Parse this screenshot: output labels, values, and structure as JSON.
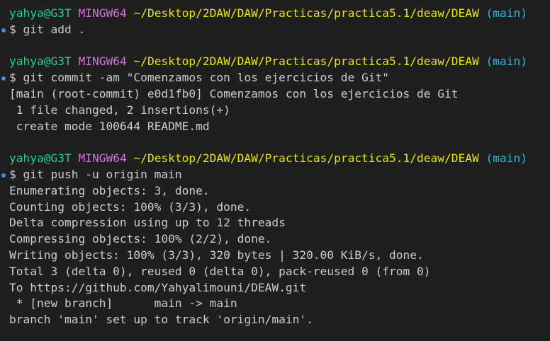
{
  "prompt": {
    "user": "yahya@G3T",
    "system": "MINGW64",
    "path": "~/Desktop/2DAW/DAW/Practicas/practica5.1/deaw/DEAW",
    "branch": "(main)"
  },
  "colors": {
    "background": "#1f1f1f",
    "text": "#cccccc",
    "user": "#23d18b",
    "system": "#d670d6",
    "path": "#e5e510",
    "branch": "#29b8db",
    "command_marker": "#3b8eea"
  },
  "lines": [
    {
      "type": "prompt"
    },
    {
      "type": "command",
      "text": "$ git add ."
    },
    {
      "type": "blank"
    },
    {
      "type": "prompt"
    },
    {
      "type": "command",
      "text": "$ git commit -am \"Comenzamos con los ejercicios de Git\""
    },
    {
      "type": "output",
      "text": "[main (root-commit) e0d1fb0] Comenzamos con los ejercicios de Git"
    },
    {
      "type": "output",
      "text": " 1 file changed, 2 insertions(+)"
    },
    {
      "type": "output",
      "text": " create mode 100644 README.md"
    },
    {
      "type": "blank"
    },
    {
      "type": "prompt"
    },
    {
      "type": "command",
      "text": "$ git push -u origin main"
    },
    {
      "type": "output",
      "text": "Enumerating objects: 3, done."
    },
    {
      "type": "output",
      "text": "Counting objects: 100% (3/3), done."
    },
    {
      "type": "output",
      "text": "Delta compression using up to 12 threads"
    },
    {
      "type": "output",
      "text": "Compressing objects: 100% (2/2), done."
    },
    {
      "type": "output",
      "text": "Writing objects: 100% (3/3), 320 bytes | 320.00 KiB/s, done."
    },
    {
      "type": "output",
      "text": "Total 3 (delta 0), reused 0 (delta 0), pack-reused 0 (from 0)"
    },
    {
      "type": "output",
      "text": "To https://github.com/Yahyalimouni/DEAW.git"
    },
    {
      "type": "output",
      "text": " * [new branch]      main -> main"
    },
    {
      "type": "output",
      "text": "branch 'main' set up to track 'origin/main'."
    }
  ]
}
